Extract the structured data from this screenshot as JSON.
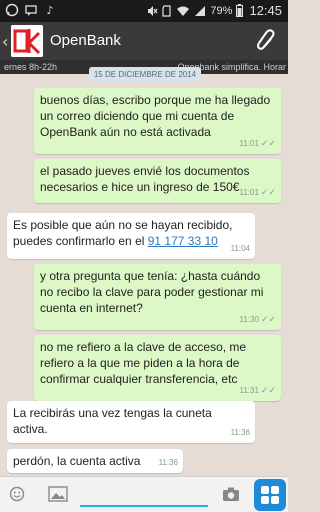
{
  "status_bar": {
    "battery_percent": "79%",
    "time": "12:45",
    "left_icons": [
      "whatsapp-notification-icon",
      "message-notification-icon",
      "music-icon"
    ],
    "right_icons": [
      "mute-icon",
      "sd-card-icon",
      "wifi-icon",
      "signal-icon",
      "battery-icon"
    ]
  },
  "header": {
    "title": "OpenBank",
    "banner_left": "ernes 8h-22h",
    "banner_right": "Openbank simplifica. Horar",
    "accent_color": "#e31e24"
  },
  "chat": {
    "date_label": "15 DE DICIEMBRE DE 2014",
    "messages": [
      {
        "direction": "out",
        "text": "buenos días, escribo porque me ha llegado un correo diciendo que mi cuenta de OpenBank aún no está activada",
        "time": "11:01",
        "ticks": "✓✓"
      },
      {
        "direction": "out",
        "text": "el pasado jueves envié los documentos necesarios e hice un ingreso de 150€",
        "time": "11:01",
        "ticks": "✓✓"
      },
      {
        "direction": "in",
        "text": "Es posible que aún no se hayan recibido, puedes confirmarlo en el ",
        "phone": "91 177 33 10",
        "time": "11:04"
      },
      {
        "direction": "out",
        "text": "y otra pregunta que tenía: ¿hasta cuándo no recibo la clave para poder gestionar mi cuenta en internet?",
        "time": "11:30",
        "ticks": "✓✓"
      },
      {
        "direction": "out",
        "text": "no me refiero a la clave de acceso, me refiero a la que me piden a la hora de confirmar cualquier transferencia, etc",
        "time": "11:31",
        "ticks": "✓✓"
      },
      {
        "direction": "in",
        "text": "La recibirás una vez tengas la cuneta activa.",
        "time": "11:36"
      },
      {
        "direction": "in",
        "text": "perdón, la cuenta activa",
        "time": "11:36"
      }
    ]
  },
  "input": {
    "placeholder": "",
    "value": ""
  }
}
